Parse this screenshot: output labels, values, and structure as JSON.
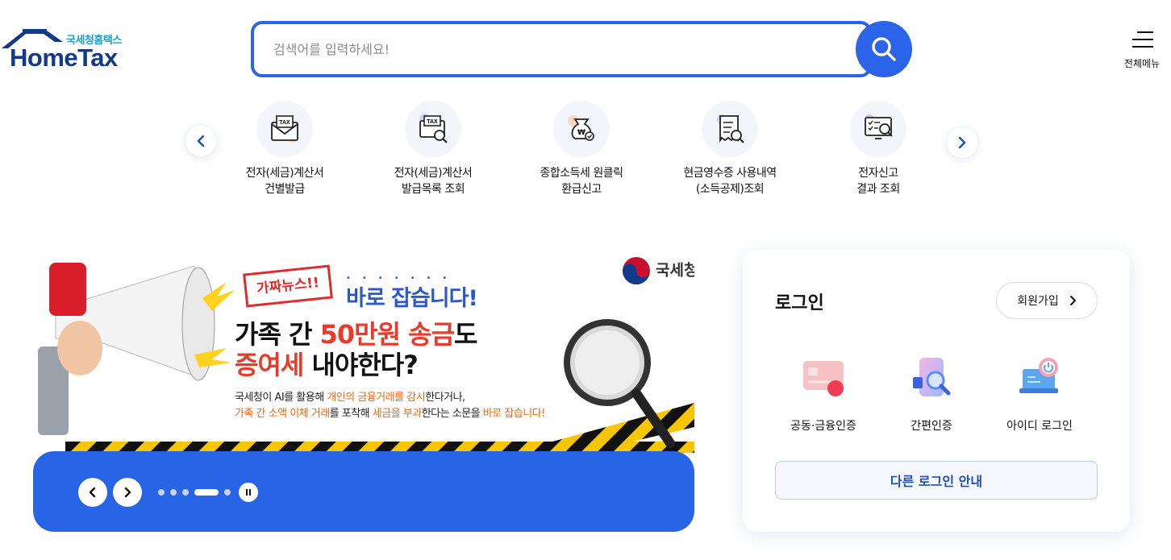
{
  "header": {
    "logo_sub": "국세청홈택스",
    "logo_main": "HomeTax",
    "search_placeholder": "검색어를 입력하세요!",
    "all_menu_label": "전체메뉴"
  },
  "quick_menu": [
    {
      "line1": "전자(세금)계산서",
      "line2": "건별발급",
      "icon": "tax-envelope-icon"
    },
    {
      "line1": "전자(세금)계산서",
      "line2": "발급목록 조회",
      "icon": "tax-search-icon"
    },
    {
      "line1": "종합소득세 원클릭",
      "line2": "환급신고",
      "icon": "refund-bag-icon"
    },
    {
      "line1": "현금영수증 사용내역",
      "line2": "(소득공제)조회",
      "icon": "receipt-search-icon"
    },
    {
      "line1": "전자신고",
      "line2": "결과 조회",
      "icon": "monitor-search-icon"
    }
  ],
  "banner": {
    "org": "국세청",
    "tag": "가짜뉴스!!",
    "headline1": "바로 잡습니다!",
    "headline2_a": "가족 간 ",
    "headline2_b": "50만원 송금",
    "headline2_c": "도",
    "headline3_a": "증여세",
    "headline3_b": " 내야한다?",
    "p1_a": "국세청이 AI를 활용해 ",
    "p1_b": "개인의 금융거래를 감시",
    "p1_c": "한다거나,",
    "p2_a": "가족 간 소액 이체 거래",
    "p2_b": "를 포착해 ",
    "p2_c": "세금을 부과",
    "p2_d": "한다는 소문을 ",
    "p2_e": "바로 잡습니다!",
    "slide_count": 5,
    "active_slide": 4
  },
  "login": {
    "title": "로그인",
    "join_label": "회원가입",
    "methods": [
      {
        "label": "공동·금융인증",
        "icon": "certificate-card-icon"
      },
      {
        "label": "간편인증",
        "icon": "phone-search-icon"
      },
      {
        "label": "아이디 로그인",
        "icon": "laptop-power-icon"
      }
    ],
    "other_label": "다른 로그인 안내"
  },
  "colors": {
    "primary": "#2b64e8",
    "banner_bar": "#2764e6",
    "logo_navy": "#123a8a",
    "logo_teal": "#1aa0c8",
    "alert_red": "#e73b2c",
    "alert_orange": "#f2660f"
  }
}
